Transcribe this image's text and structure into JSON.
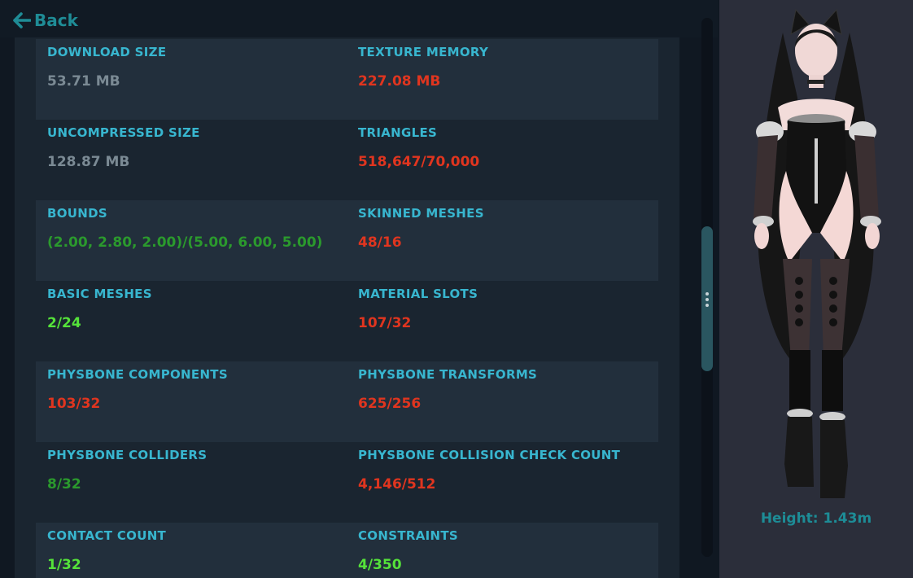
{
  "header": {
    "back_label": "Back"
  },
  "colors": {
    "label": "#38b6cf",
    "gray": "#7b8a94",
    "red": "#e0351f",
    "dark_green": "#2b9a2d",
    "bright_green": "#55e23a",
    "accent": "#1f8c96"
  },
  "stats": [
    {
      "left": {
        "label": "DOWNLOAD SIZE",
        "value": "53.71 MB",
        "status": "gray"
      },
      "right": {
        "label": "TEXTURE MEMORY",
        "value": "227.08 MB",
        "status": "red"
      }
    },
    {
      "left": {
        "label": "UNCOMPRESSED SIZE",
        "value": "128.87 MB",
        "status": "gray"
      },
      "right": {
        "label": "TRIANGLES",
        "value": "518,647/70,000",
        "status": "red"
      }
    },
    {
      "left": {
        "label": "BOUNDS",
        "value": "(2.00, 2.80, 2.00)/(5.00, 6.00, 5.00)",
        "status": "dark_green"
      },
      "right": {
        "label": "SKINNED MESHES",
        "value": "48/16",
        "status": "red"
      }
    },
    {
      "left": {
        "label": "BASIC MESHES",
        "value": "2/24",
        "status": "bright_green"
      },
      "right": {
        "label": "MATERIAL SLOTS",
        "value": "107/32",
        "status": "red"
      }
    },
    {
      "left": {
        "label": "PHYSBONE COMPONENTS",
        "value": "103/32",
        "status": "red"
      },
      "right": {
        "label": "PHYSBONE TRANSFORMS",
        "value": "625/256",
        "status": "red"
      }
    },
    {
      "left": {
        "label": "PHYSBONE COLLIDERS",
        "value": "8/32",
        "status": "dark_green"
      },
      "right": {
        "label": "PHYSBONE COLLISION CHECK COUNT",
        "value": "4,146/512",
        "status": "red"
      }
    },
    {
      "left": {
        "label": "CONTACT COUNT",
        "value": "1/32",
        "status": "bright_green"
      },
      "right": {
        "label": "CONSTRAINTS",
        "value": "4/350",
        "status": "bright_green"
      }
    }
  ],
  "avatar": {
    "height_label": "Height: 1.43m"
  }
}
